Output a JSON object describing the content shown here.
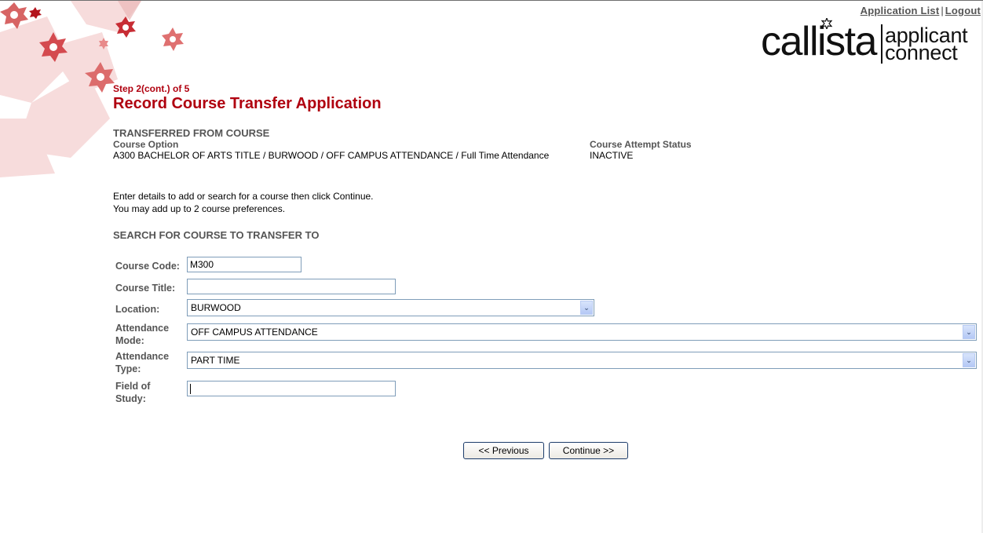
{
  "header": {
    "links": [
      {
        "label": "Application List"
      },
      {
        "label": "Logout"
      }
    ],
    "logo": {
      "brand": "callista",
      "product_line1": "applicant",
      "product_line2": "connect"
    }
  },
  "page": {
    "step": "Step 2(cont.) of 5",
    "title": "Record Course Transfer Application",
    "accent_color": "#b0000f"
  },
  "transferred_from": {
    "heading": "TRANSFERRED FROM COURSE",
    "columns": [
      "Course Option",
      "Course Attempt Status"
    ],
    "row": {
      "course_option": "A300 BACHELOR OF ARTS TITLE / BURWOOD / OFF CAMPUS ATTENDANCE / Full Time Attendance",
      "status": "INACTIVE"
    }
  },
  "instructions": [
    "Enter details to add or search for a course then click Continue.",
    "You may add up to 2 course preferences."
  ],
  "search": {
    "heading": "SEARCH FOR COURSE TO TRANSFER TO",
    "fields": {
      "course_code": {
        "label": "Course Code:",
        "value": "M300"
      },
      "course_title": {
        "label": "Course Title:",
        "value": ""
      },
      "location": {
        "label": "Location:",
        "value": "BURWOOD"
      },
      "attendance_mode": {
        "label_line1": "Attendance",
        "label_line2": "Mode:",
        "value": "OFF CAMPUS ATTENDANCE"
      },
      "attendance_type": {
        "label_line1": "Attendance",
        "label_line2": "Type:",
        "value": "PART TIME"
      },
      "field_of_study": {
        "label_line1": "Field of",
        "label_line2": "Study:",
        "value": ""
      }
    }
  },
  "buttons": {
    "previous": "<< Previous",
    "continue": "Continue >>"
  }
}
